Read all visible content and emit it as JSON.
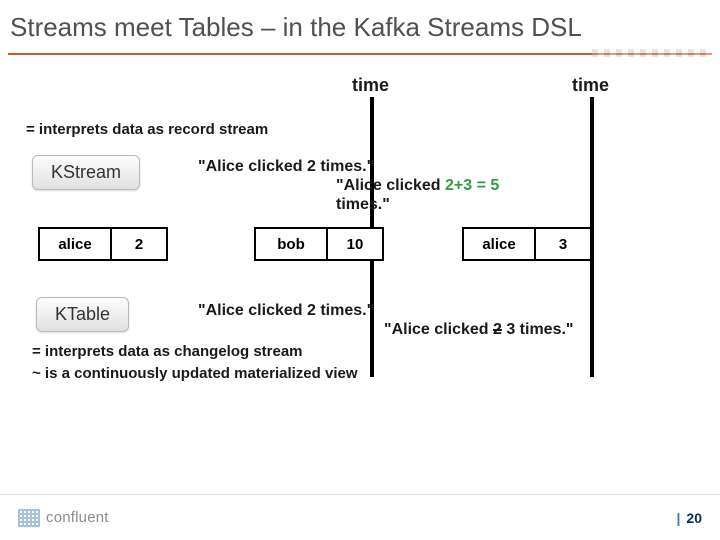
{
  "title": "Streams meet Tables – in the Kafka Streams DSL",
  "timeLabels": {
    "t1": "time",
    "t2": "time"
  },
  "kstream": {
    "badge": "KStream",
    "interpret": "= interprets data as record stream",
    "speech1_a": "\"Alice clicked 2 times.\"",
    "speech2_a": "\"Alice clicked ",
    "speech2_math": "2+3 = 5",
    "speech2_b": "\ntimes.\""
  },
  "records": [
    {
      "key": "alice",
      "val": "2"
    },
    {
      "key": "bob",
      "val": "10"
    },
    {
      "key": "alice",
      "val": "3"
    }
  ],
  "ktable": {
    "badge": "KTable",
    "speech1": "\"Alice clicked 2 times.\"",
    "speech2_a": "\"Alice clicked ",
    "speech2_strike": "2",
    "speech2_b": " 3 times.\"",
    "interpret1": "= interprets data as changelog stream",
    "interpret2": "~ is a continuously updated materialized view"
  },
  "footer": {
    "brand": "confluent",
    "page": "20"
  }
}
